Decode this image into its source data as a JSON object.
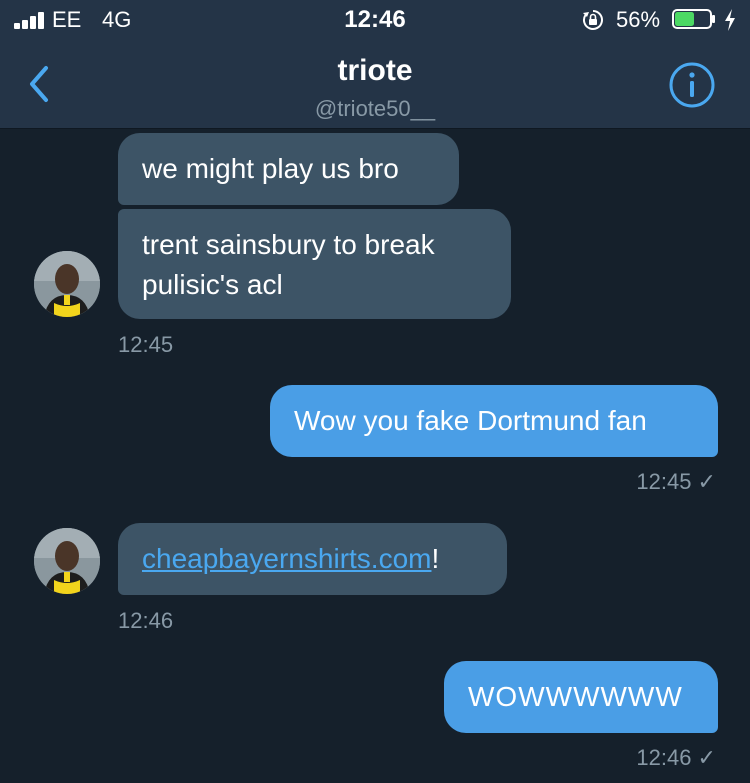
{
  "status_bar": {
    "carrier": "EE",
    "network": "4G",
    "time": "12:46",
    "battery_percent": "56%",
    "battery_level": 0.56
  },
  "header": {
    "title": "triote",
    "handle": "@triote50__"
  },
  "messages": [
    {
      "direction": "incoming",
      "text": "we might play us bro"
    },
    {
      "direction": "incoming",
      "text_line1": "trent sainsbury to break",
      "text_line2": "pulisic's acl",
      "timestamp": "12:45"
    },
    {
      "direction": "outgoing",
      "text": "Wow you fake Dortmund fan",
      "timestamp": "12:45 ✓"
    },
    {
      "direction": "incoming",
      "link_text": "cheapbayernshirts.com",
      "suffix": "!",
      "timestamp": "12:46"
    },
    {
      "direction": "outgoing",
      "text": "WOWWWWWW",
      "timestamp": "12:46 ✓"
    }
  ],
  "colors": {
    "background": "#15202b",
    "header_bg": "#243447",
    "incoming_bubble": "#3d5466",
    "outgoing_bubble": "#4a9ee6",
    "link": "#4aa8f0",
    "muted_text": "#8899a6",
    "battery_fill": "#4cd964"
  },
  "icons": {
    "back": "chevron-left-icon",
    "info": "info-circle-icon",
    "signal": "signal-bars-icon",
    "orientation_lock": "orientation-lock-icon",
    "battery": "battery-icon",
    "charging": "lightning-bolt-icon"
  }
}
